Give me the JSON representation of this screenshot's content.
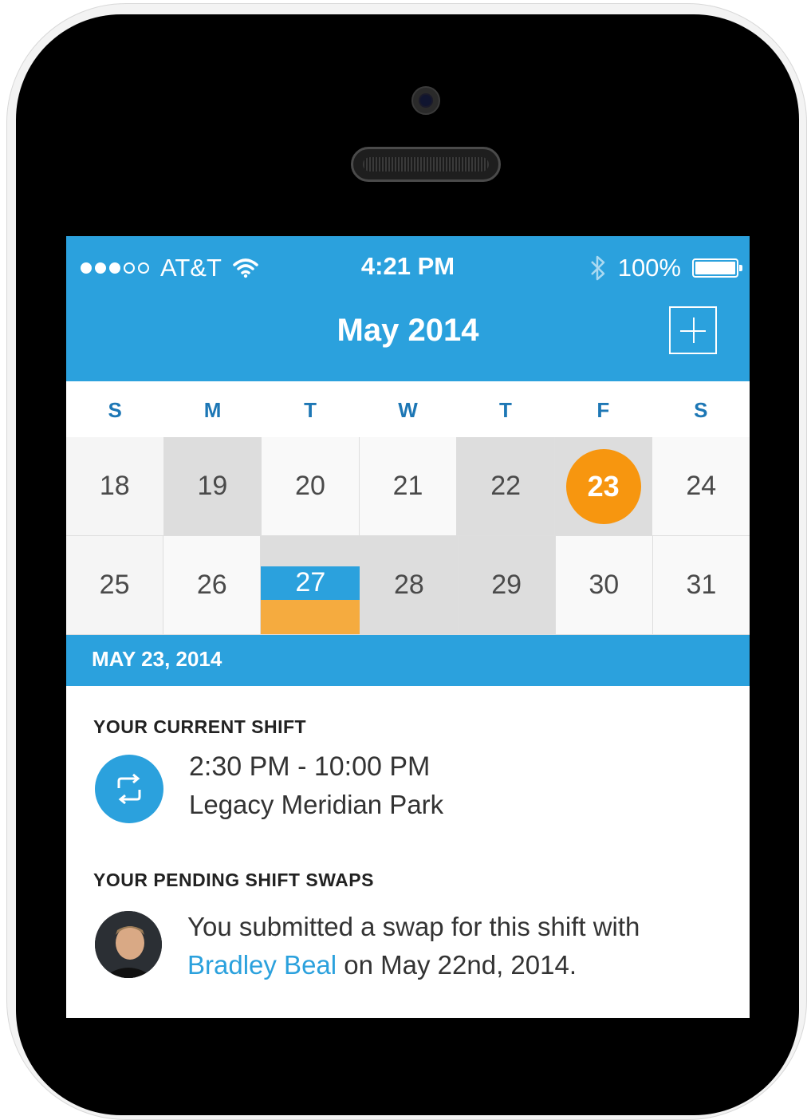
{
  "status_bar": {
    "carrier": "AT&T",
    "time": "4:21 PM",
    "battery": "100%"
  },
  "nav": {
    "title": "May 2014",
    "add_icon": "plus-icon"
  },
  "calendar": {
    "weekdays": [
      "S",
      "M",
      "T",
      "W",
      "T",
      "F",
      "S"
    ],
    "week1": [
      "18",
      "19",
      "20",
      "21",
      "22",
      "23",
      "24"
    ],
    "week2": [
      "25",
      "26",
      "27",
      "28",
      "29",
      "30",
      "31"
    ],
    "selected_day": "23"
  },
  "selected_date_label": "MAY 23, 2014",
  "current_shift": {
    "heading": "YOUR CURRENT SHIFT",
    "time": "2:30 PM - 10:00 PM",
    "location": "Legacy Meridian Park",
    "icon": "swap-icon"
  },
  "pending_swaps": {
    "heading": "YOUR PENDING SHIFT SWAPS",
    "text_before": "You submitted a swap for this shift with ",
    "person": "Bradley Beal",
    "text_after": " on May 22nd, 2014."
  },
  "colors": {
    "brand_blue": "#2ba1dd",
    "today_orange": "#f7960f",
    "event_orange": "#f5ab3f"
  }
}
